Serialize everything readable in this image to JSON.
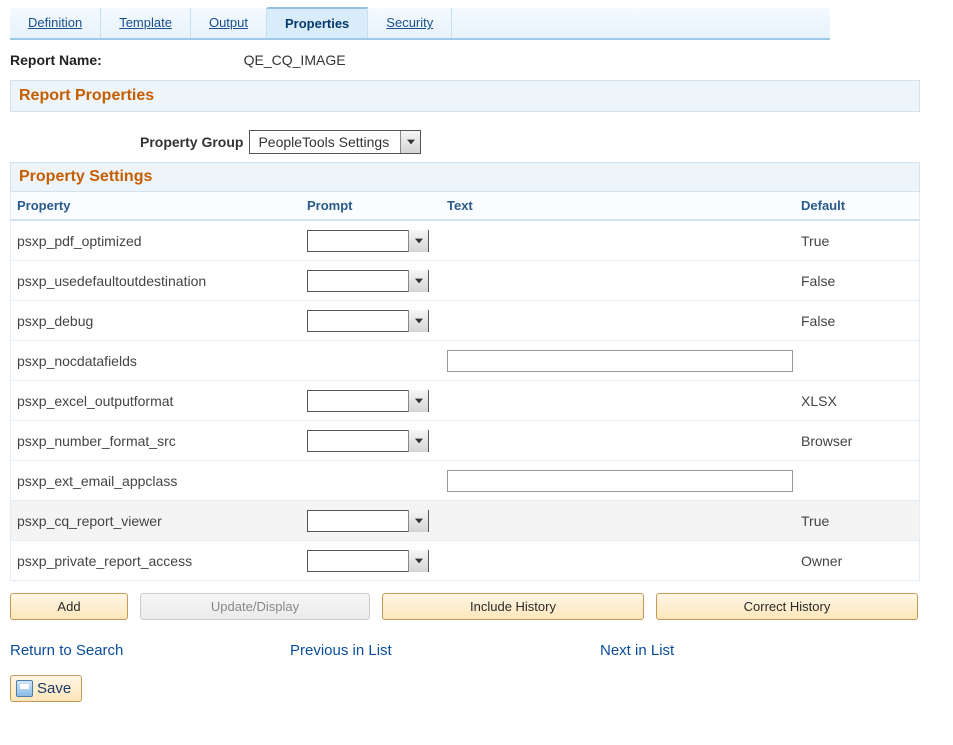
{
  "tabs": [
    {
      "label": "Definition",
      "active": false
    },
    {
      "label": "Template",
      "active": false
    },
    {
      "label": "Output",
      "active": false
    },
    {
      "label": "Properties",
      "active": true
    },
    {
      "label": "Security",
      "active": false
    }
  ],
  "reportName": {
    "label": "Report Name:",
    "value": "QE_CQ_IMAGE"
  },
  "sections": {
    "reportProperties": "Report Properties",
    "propertySettings": "Property Settings"
  },
  "propertyGroup": {
    "label": "Property Group",
    "selected": "PeopleTools Settings"
  },
  "columns": {
    "property": "Property",
    "prompt": "Prompt",
    "text": "Text",
    "default": "Default"
  },
  "rows": [
    {
      "property": "psxp_pdf_optimized",
      "prompt": "",
      "text": null,
      "default": "True",
      "hasPrompt": true,
      "hasText": false
    },
    {
      "property": "psxp_usedefaultoutdestination",
      "prompt": "",
      "text": null,
      "default": "False",
      "hasPrompt": true,
      "hasText": false
    },
    {
      "property": "psxp_debug",
      "prompt": "",
      "text": null,
      "default": "False",
      "hasPrompt": true,
      "hasText": false
    },
    {
      "property": "psxp_nocdatafields",
      "prompt": null,
      "text": "",
      "default": "",
      "hasPrompt": false,
      "hasText": true
    },
    {
      "property": "psxp_excel_outputformat",
      "prompt": "",
      "text": null,
      "default": "XLSX",
      "hasPrompt": true,
      "hasText": false
    },
    {
      "property": "psxp_number_format_src",
      "prompt": "",
      "text": null,
      "default": "Browser",
      "hasPrompt": true,
      "hasText": false
    },
    {
      "property": "psxp_ext_email_appclass",
      "prompt": null,
      "text": "",
      "default": "",
      "hasPrompt": false,
      "hasText": true
    },
    {
      "property": "psxp_cq_report_viewer",
      "prompt": "",
      "text": null,
      "default": "True",
      "hasPrompt": true,
      "hasText": false,
      "highlight": true
    },
    {
      "property": "psxp_private_report_access",
      "prompt": "",
      "text": null,
      "default": "Owner",
      "hasPrompt": true,
      "hasText": false
    }
  ],
  "buttons": {
    "add": "Add",
    "updateDisplay": "Update/Display",
    "includeHistory": "Include History",
    "correctHistory": "Correct History"
  },
  "links": {
    "returnToSearch": "Return to Search",
    "previousInList": "Previous in List",
    "nextInList": "Next in List"
  },
  "save": "Save"
}
